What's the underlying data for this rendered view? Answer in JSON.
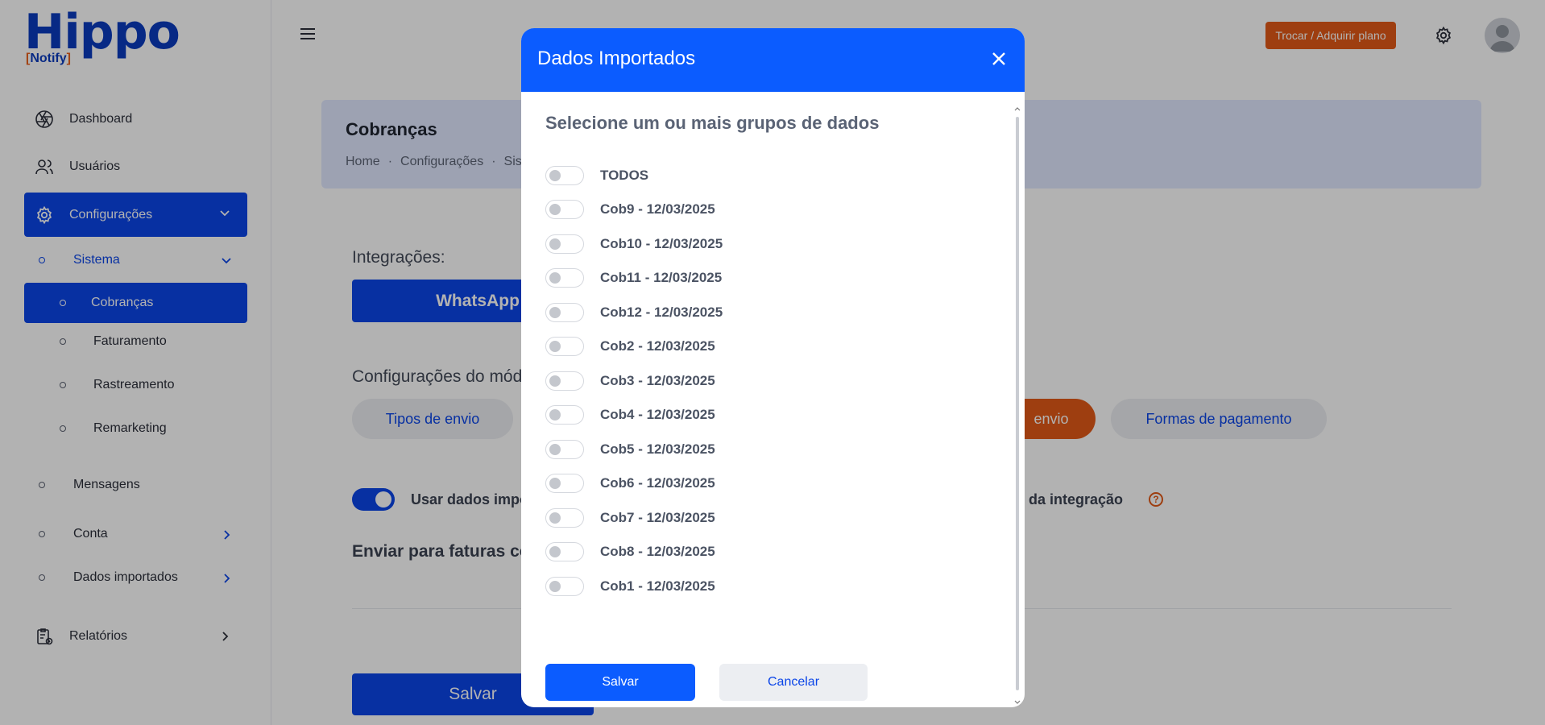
{
  "brand": {
    "logo_text": "Hippo",
    "logo_sub": "Notify"
  },
  "sidebar": {
    "dashboard": "Dashboard",
    "usuarios": "Usuários",
    "configuracoes": "Configurações",
    "sistema": "Sistema",
    "cobrancas": "Cobranças",
    "faturamento": "Faturamento",
    "rastreamento": "Rastreamento",
    "remarketing": "Remarketing",
    "mensagens": "Mensagens",
    "conta": "Conta",
    "dados_importados": "Dados importados",
    "relatorios": "Relatórios"
  },
  "header": {
    "plan_button": "Trocar / Adquirir plano"
  },
  "page": {
    "title": "Cobranças",
    "breadcrumb": [
      "Home",
      "Configurações",
      "Sis"
    ],
    "integracoes_label": "Integrações:",
    "whatsapp_button": "WhatsApp",
    "config_label": "Configurações do mód",
    "tab_tipos": "Tipos de envio",
    "tab_envio": "envio",
    "tab_formas": "Formas de pagamento",
    "usar_dados": "Usar dados impo",
    "dados_integracao": "dos da integração",
    "help": "?",
    "enviar_label": "Enviar para faturas com",
    "salvar_bg": "Salvar"
  },
  "modal": {
    "title": "Dados Importados",
    "subtitle": "Selecione um ou mais grupos de dados",
    "options": [
      "TODOS",
      "Cob9 - 12/03/2025",
      "Cob10 - 12/03/2025",
      "Cob11 - 12/03/2025",
      "Cob12 - 12/03/2025",
      "Cob2 - 12/03/2025",
      "Cob3 - 12/03/2025",
      "Cob4 - 12/03/2025",
      "Cob5 - 12/03/2025",
      "Cob6 - 12/03/2025",
      "Cob7 - 12/03/2025",
      "Cob8 - 12/03/2025",
      "Cob1 - 12/03/2025"
    ],
    "save": "Salvar",
    "cancel": "Cancelar"
  },
  "colors": {
    "primary": "#0b45e8",
    "modal_header": "#0b5cff",
    "accent": "#e25a17"
  }
}
